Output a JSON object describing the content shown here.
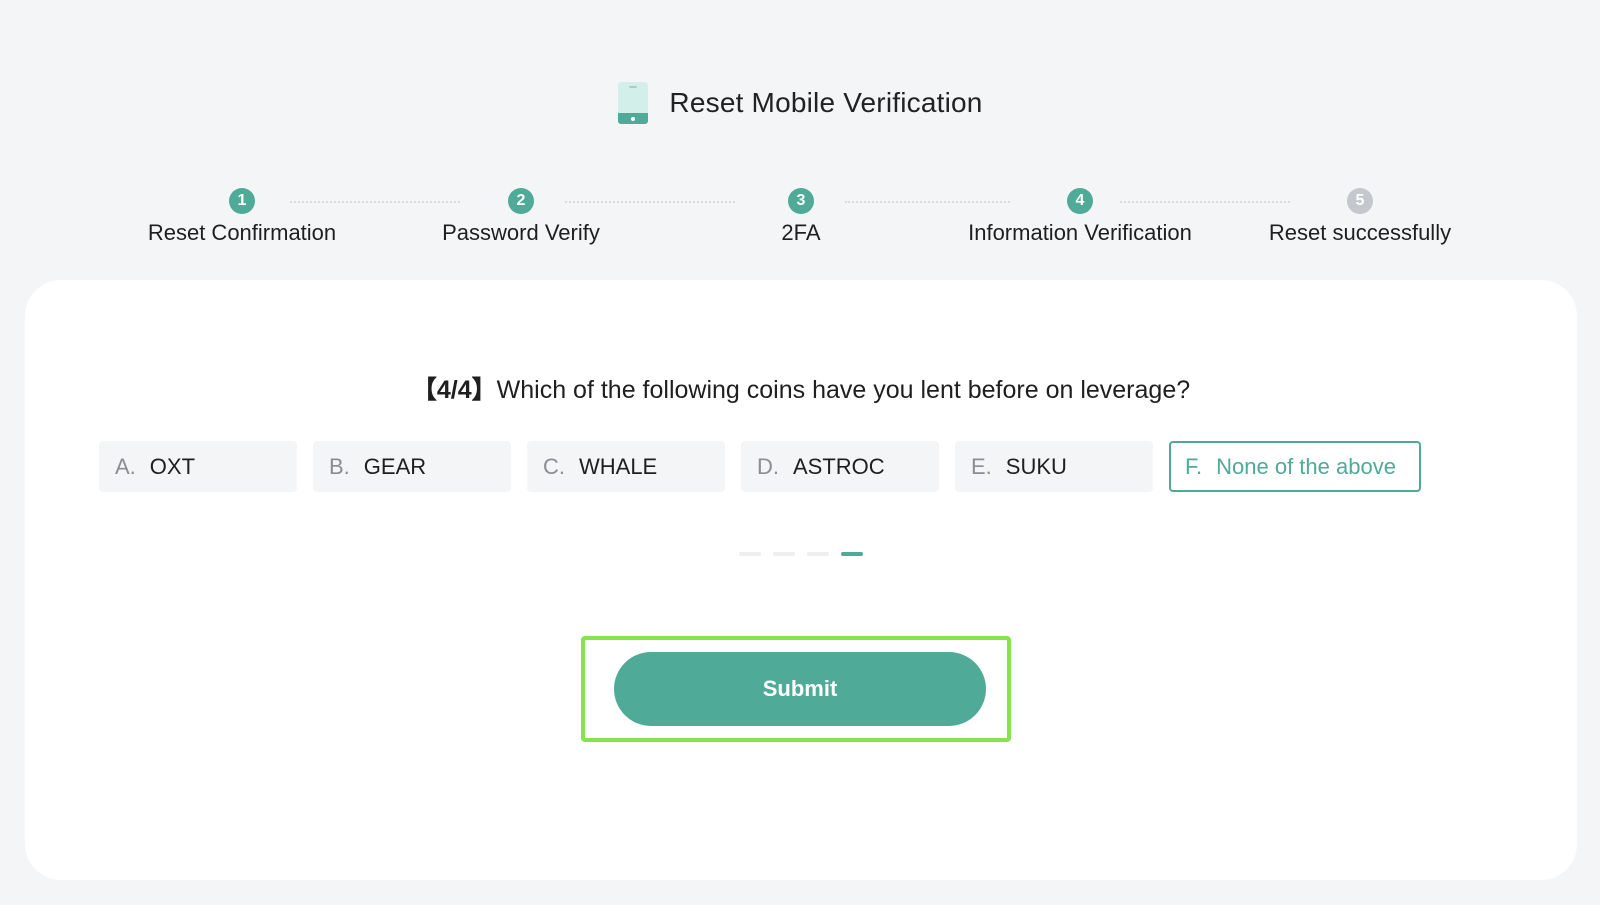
{
  "header": {
    "title": "Reset Mobile Verification",
    "icon": "mobile-phone-icon",
    "icon_color": "#4faa98"
  },
  "stepper": {
    "steps": [
      {
        "number": "1",
        "label": "Reset Confirmation",
        "status": "done"
      },
      {
        "number": "2",
        "label": "Password Verify",
        "status": "done"
      },
      {
        "number": "3",
        "label": "2FA",
        "status": "done"
      },
      {
        "number": "4",
        "label": "Information Verification",
        "status": "current"
      },
      {
        "number": "5",
        "label": "Reset successfully",
        "status": "pending"
      }
    ],
    "active_color": "#4faa98",
    "pending_color": "#c4c7cc"
  },
  "question": {
    "number": "【4/4】",
    "text": "Which of the following coins have you lent before on leverage?"
  },
  "options": [
    {
      "letter": "A.",
      "text": "OXT",
      "selected": false
    },
    {
      "letter": "B.",
      "text": "GEAR",
      "selected": false
    },
    {
      "letter": "C.",
      "text": "WHALE",
      "selected": false
    },
    {
      "letter": "D.",
      "text": "ASTROC",
      "selected": false
    },
    {
      "letter": "E.",
      "text": "SUKU",
      "selected": false
    },
    {
      "letter": "F.",
      "text": "None of the above",
      "selected": true
    }
  ],
  "pager": {
    "total": 4,
    "current": 4
  },
  "submit": {
    "label": "Submit",
    "color": "#4faa98",
    "highlight_color": "#86e34c"
  }
}
